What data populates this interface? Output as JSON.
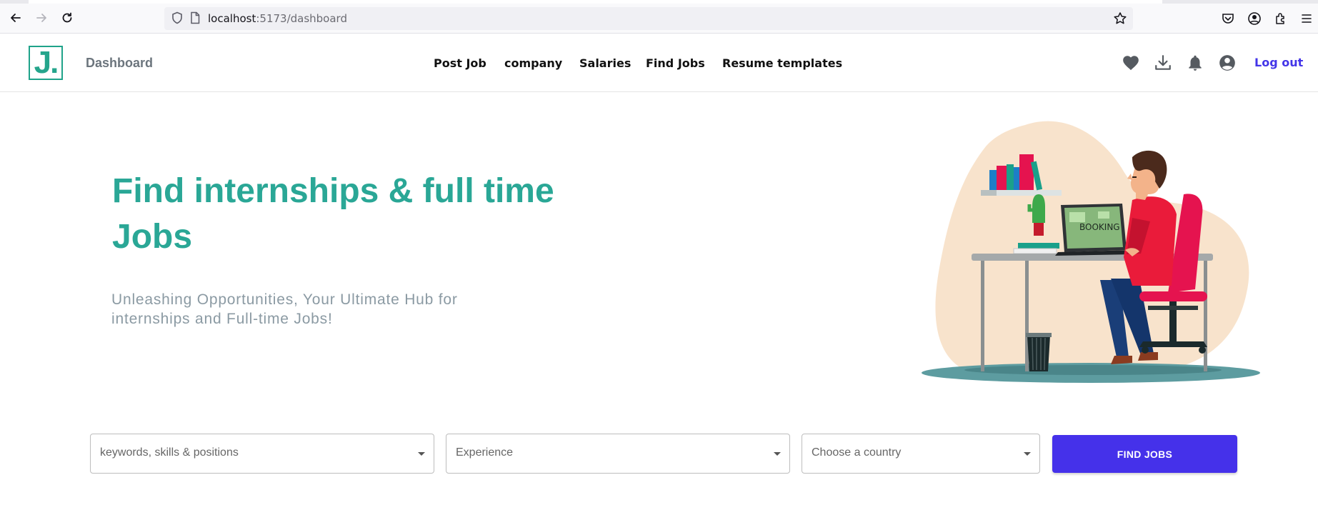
{
  "browser": {
    "url_host": "localhost",
    "url_path": ":5173/dashboard"
  },
  "nav": {
    "brand": "J.",
    "dashboard": "Dashboard",
    "menu": [
      "Post Job",
      "company",
      "Salaries",
      "Find Jobs",
      "Resume templates"
    ],
    "logout": "Log out",
    "icons": [
      "heart-icon",
      "download-icon",
      "bell-icon",
      "account-icon"
    ]
  },
  "hero": {
    "title_line1": "Find internships & full time",
    "title_line2": "Jobs",
    "subtitle_line1": "Unleashing Opportunities, Your Ultimate Hub for",
    "subtitle_line2": "internships and Full-time Jobs!",
    "laptop_text": "BOOKING"
  },
  "search": {
    "keywords_placeholder": "keywords, skills & positions",
    "experience_placeholder": "Experience",
    "country_placeholder": "Choose a country",
    "button_label": "FIND JOBS"
  },
  "colors": {
    "accent": "#2aa796",
    "primary_button": "#4531ea",
    "logout": "#4335e8"
  }
}
